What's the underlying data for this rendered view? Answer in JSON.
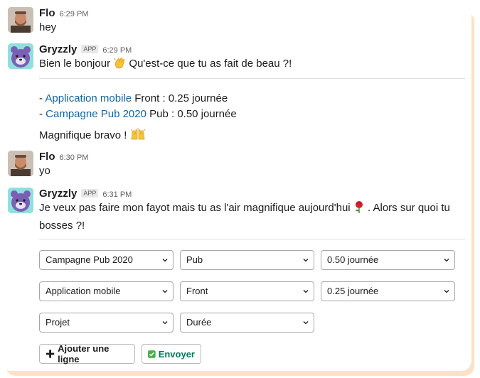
{
  "messages": [
    {
      "name": "Flo",
      "time": "6:29 PM",
      "text": "hey"
    },
    {
      "name": "Gryzzly",
      "badge": "APP",
      "time": "6:29 PM",
      "text_before": "Bien le bonjour",
      "text_after": "Qu'est-ce que tu as fait de beau ?!"
    },
    {
      "name": "Flo",
      "time": "6:30 PM",
      "text": "yo"
    },
    {
      "name": "Gryzzly",
      "badge": "APP",
      "time": "6:31 PM",
      "line1_before": "Je veux pas faire mon fayot mais tu as l'air magnifique aujourd'hui",
      "line1_after": ". Alors sur quoi tu",
      "line2": "bosses ?!"
    }
  ],
  "summary": {
    "lines": [
      {
        "prefix": "- ",
        "project": "Application mobile",
        "detail": " Front : 0.25 journée"
      },
      {
        "prefix": "- ",
        "project": "Campagne Pub 2020",
        "detail": " Pub : 0.50 journée"
      }
    ],
    "bravo": "Magnifique bravo !"
  },
  "form": {
    "rows": [
      {
        "project": "Campagne Pub 2020",
        "task": "Pub",
        "duration": "0.50 journée"
      },
      {
        "project": "Application mobile",
        "task": "Front",
        "duration": "0.25 journée"
      },
      {
        "project": "Projet",
        "task": "Durée"
      }
    ],
    "add_line_label": "Ajouter une ligne",
    "send_label": "Envoyer"
  },
  "colors": {
    "link": "#1264a3",
    "accent_frame": "#fbe2c5",
    "send_green": "#007a5a"
  },
  "icons": [
    "waving-hand-icon",
    "raised-hands-icon",
    "rose-icon",
    "plus-icon",
    "check-icon",
    "chevron-down-icon"
  ]
}
